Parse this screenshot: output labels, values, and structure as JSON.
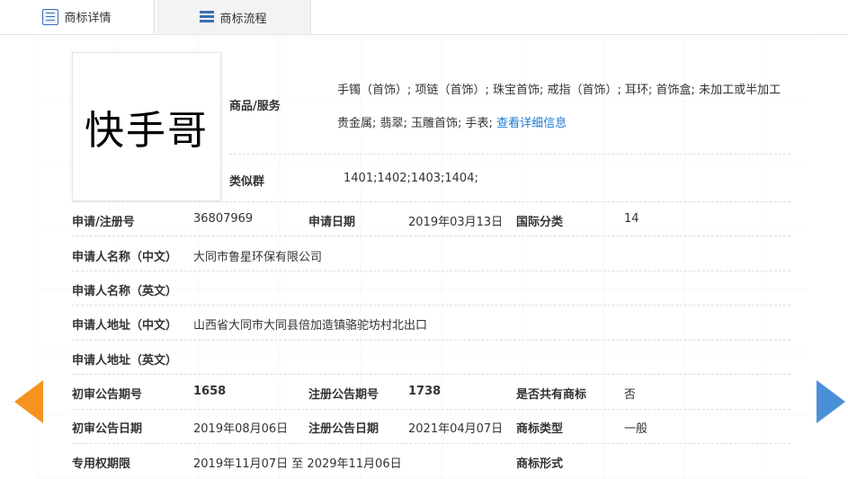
{
  "tabs": [
    {
      "label": "商标详情"
    },
    {
      "label": "商标流程"
    }
  ],
  "logo_text": "快手哥",
  "goods": {
    "label": "商品/服务",
    "line1": "手镯（首饰）; 项链（首饰）; 珠宝首饰; 戒指（首饰）; 耳环; 首饰盒; 未加工或半加工",
    "line2": "贵金属; 翡翠; 玉雕首饰; 手表;",
    "detail_link": "查看详细信息"
  },
  "similar_group": {
    "label": "类似群",
    "value": "1401;1402;1403;1404;"
  },
  "rows": {
    "reg_no": {
      "label": "申请/注册号",
      "value": "36807969"
    },
    "apply_date": {
      "label": "申请日期",
      "value": "2019年03月13日"
    },
    "intl_class": {
      "label": "国际分类",
      "value": "14"
    },
    "applicant_cn": {
      "label": "申请人名称（中文）",
      "value": "大同市鲁星环保有限公司"
    },
    "applicant_en": {
      "label": "申请人名称（英文）",
      "value": ""
    },
    "address_cn": {
      "label": "申请人地址（中文）",
      "value": "山西省大同市大同县倍加造镇骆驼坊村北出口"
    },
    "address_en": {
      "label": "申请人地址（英文）",
      "value": ""
    },
    "prelim_no": {
      "label": "初审公告期号",
      "value": "1658"
    },
    "reg_pub_no": {
      "label": "注册公告期号",
      "value": "1738"
    },
    "shared": {
      "label": "是否共有商标",
      "value": "否"
    },
    "prelim_date": {
      "label": "初审公告日期",
      "value": "2019年08月06日"
    },
    "reg_pub_date": {
      "label": "注册公告日期",
      "value": "2021年04月07日"
    },
    "tm_type": {
      "label": "商标类型",
      "value": "一般"
    },
    "exclusive_period": {
      "label": "专用权期限",
      "value": "2019年11月07日 至 2029年11月06日"
    },
    "tm_form": {
      "label": "商标形式",
      "value": ""
    }
  },
  "colors": {
    "link": "#1a7bd4",
    "prev_arrow": "#f5931e",
    "next_arrow": "#4a90d9",
    "tab_icon": "#3a6fb5"
  }
}
